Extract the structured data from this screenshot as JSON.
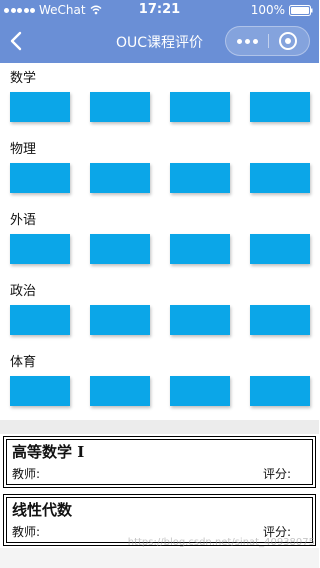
{
  "status_bar": {
    "carrier": "WeChat",
    "time": "17:21",
    "battery": "100%"
  },
  "nav": {
    "title": "OUC课程评价"
  },
  "subjects": [
    {
      "label": "数学",
      "buttons": 4
    },
    {
      "label": "物理",
      "buttons": 4
    },
    {
      "label": "外语",
      "buttons": 4
    },
    {
      "label": "政治",
      "buttons": 4
    },
    {
      "label": "体育",
      "buttons": 4
    }
  ],
  "courses": [
    {
      "name": "高等数学 I",
      "teacher_label": "教师:",
      "rating_label": "评分:"
    },
    {
      "name": "线性代数",
      "teacher_label": "教师:",
      "rating_label": "评分:"
    }
  ],
  "watermark": "https://blog.csdn.net/sinat_40938075",
  "colors": {
    "nav_background": "#6a8fd6",
    "course_button": "#0ba6e8"
  }
}
